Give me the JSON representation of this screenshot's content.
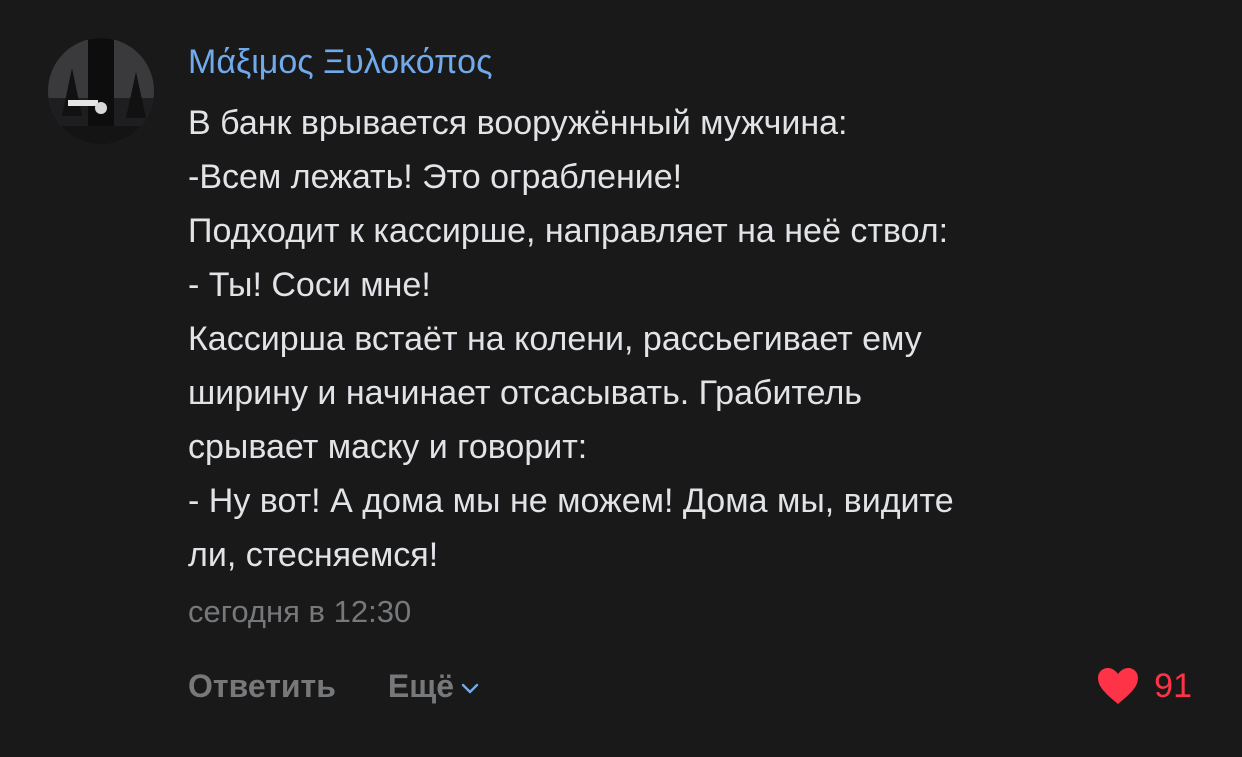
{
  "comment": {
    "author": "Μάξιμος Ξυλοκόπος",
    "lines": [
      "В банк врывается вооружённый мужчина:",
      "-Всем лежать! Это ограбление!",
      "Подходит к кассирше, направляет на неё ствол:",
      "- Ты! Соси мне!",
      "Кассирша встаёт на колени, рассьегивает ему",
      "ширину и начинает отсасывать. Грабитель",
      "срывает маску и говорит:",
      "- Ну вот! А дома мы не можем! Дома мы, видите",
      "ли, стесняемся!"
    ],
    "timestamp": "сегодня в 12:30"
  },
  "actions": {
    "reply_label": "Ответить",
    "more_label": "Ещё",
    "more_icon": "chevron-down-icon",
    "like_icon": "heart-icon",
    "like_count": "91"
  },
  "colors": {
    "background": "#19191a",
    "author": "#71aaeb",
    "text": "#e1e3e6",
    "secondary": "#76787a",
    "like": "#ff3347"
  }
}
